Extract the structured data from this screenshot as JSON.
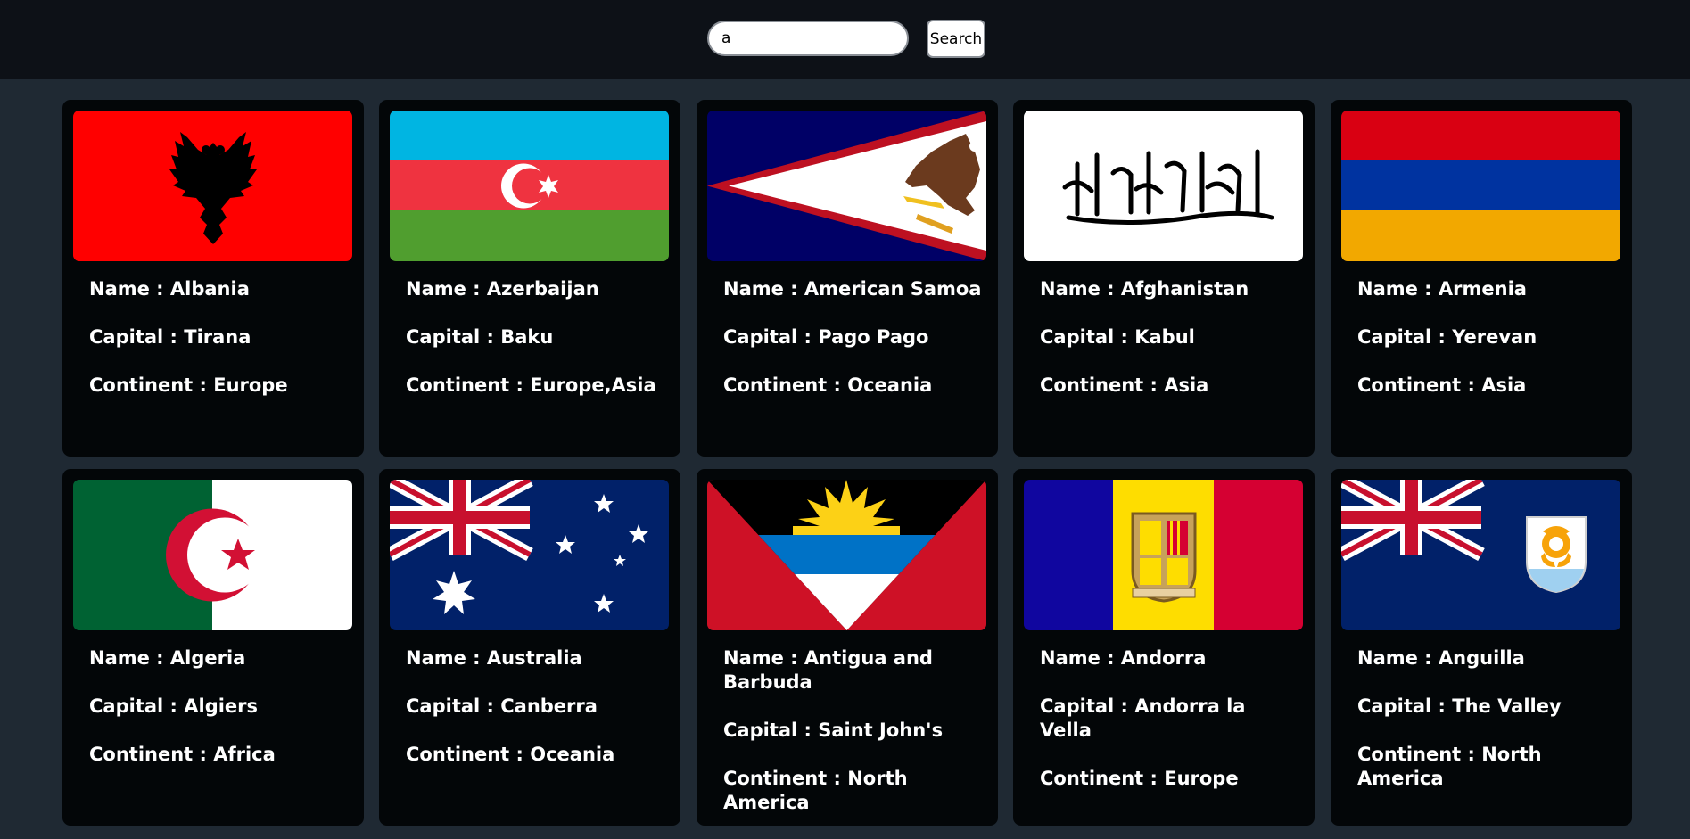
{
  "search": {
    "value": "a",
    "button_label": "Search"
  },
  "countries": [
    {
      "name": "Name : Albania",
      "capital": "Capital : Tirana",
      "continent": "Continent : Europe"
    },
    {
      "name": "Name : Azerbaijan",
      "capital": "Capital : Baku",
      "continent": "Continent : Europe,Asia"
    },
    {
      "name": "Name : American Samoa",
      "capital": "Capital : Pago Pago",
      "continent": "Continent : Oceania"
    },
    {
      "name": "Name : Afghanistan",
      "capital": "Capital : Kabul",
      "continent": "Continent : Asia"
    },
    {
      "name": "Name : Armenia",
      "capital": "Capital : Yerevan",
      "continent": "Continent : Asia"
    },
    {
      "name": "Name : Algeria",
      "capital": "Capital : Algiers",
      "continent": "Continent : Africa"
    },
    {
      "name": "Name : Australia",
      "capital": "Capital : Canberra",
      "continent": "Continent : Oceania"
    },
    {
      "name": "Name : Antigua and Barbuda",
      "capital": "Capital : Saint John's",
      "continent": "Continent : North America"
    },
    {
      "name": "Name : Andorra",
      "capital": "Capital : Andorra la Vella",
      "continent": "Continent : Europe"
    },
    {
      "name": "Name : Anguilla",
      "capital": "Capital : The Valley",
      "continent": "Continent : North America"
    }
  ],
  "flags": [
    {
      "country": "Albania",
      "icon": "albania-flag-icon",
      "colors": [
        "#ff0000",
        "#000000"
      ]
    },
    {
      "country": "Azerbaijan",
      "icon": "azerbaijan-flag-icon",
      "colors": [
        "#00b5e2",
        "#ef3340",
        "#509e2f"
      ]
    },
    {
      "country": "American Samoa",
      "icon": "american-samoa-flag-icon",
      "colors": [
        "#000066",
        "#bd1021",
        "#ffffff"
      ]
    },
    {
      "country": "Afghanistan",
      "icon": "afghanistan-flag-icon",
      "colors": [
        "#ffffff",
        "#000000"
      ]
    },
    {
      "country": "Armenia",
      "icon": "armenia-flag-icon",
      "colors": [
        "#d90012",
        "#0033a0",
        "#f2a800"
      ]
    },
    {
      "country": "Algeria",
      "icon": "algeria-flag-icon",
      "colors": [
        "#006233",
        "#ffffff",
        "#d21034"
      ]
    },
    {
      "country": "Australia",
      "icon": "australia-flag-icon",
      "colors": [
        "#012169",
        "#c8102e",
        "#ffffff"
      ]
    },
    {
      "country": "Antigua and Barbuda",
      "icon": "antigua-barbuda-flag-icon",
      "colors": [
        "#ce1126",
        "#000000",
        "#0072c6",
        "#fcd116"
      ]
    },
    {
      "country": "Andorra",
      "icon": "andorra-flag-icon",
      "colors": [
        "#10069f",
        "#fedd00",
        "#d50032"
      ]
    },
    {
      "country": "Anguilla",
      "icon": "anguilla-flag-icon",
      "colors": [
        "#012169",
        "#c8102e",
        "#f7a30a"
      ]
    }
  ]
}
